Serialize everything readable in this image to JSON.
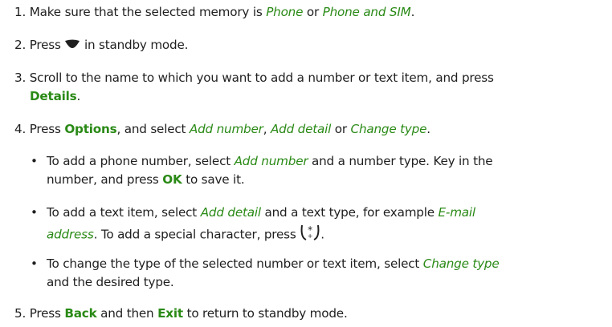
{
  "steps": [
    {
      "number": "1.",
      "parts": [
        "Make sure that the selected memory is ",
        "Phone",
        " or ",
        "Phone and SIM",
        "."
      ]
    },
    {
      "number": "2.",
      "parts": [
        "Press ",
        " in standby mode."
      ],
      "icon": "scroll-down-key-icon"
    },
    {
      "number": "3.",
      "parts": [
        "Scroll to the name to which you want to add a number or text item, and press",
        "Details",
        "."
      ]
    },
    {
      "number": "4.",
      "parts": [
        "Press ",
        "Options",
        ", and select ",
        "Add number",
        ", ",
        "Add detail",
        " or ",
        "Change type",
        "."
      ],
      "bullets": [
        {
          "parts": [
            "To add a phone number, select ",
            "Add number",
            " and a number type. Key in the",
            "number, and press ",
            "OK",
            " to save it."
          ]
        },
        {
          "parts": [
            "To add a text item, select ",
            "Add detail",
            " and a text type, for example ",
            "E-mail",
            "address",
            ". To add a special character, press ",
            "."
          ],
          "icon": "star-key-icon"
        },
        {
          "parts": [
            "To change the type of the selected number or text item, select ",
            "Change type",
            "and the desired type."
          ]
        }
      ]
    },
    {
      "number": "5.",
      "parts": [
        "Press ",
        "Back",
        " and then ",
        "Exit",
        " to return to standby mode."
      ]
    }
  ],
  "bullet_symbol": "•",
  "colors": {
    "text": "#1f1f1f",
    "accent": "#2a8a16"
  }
}
